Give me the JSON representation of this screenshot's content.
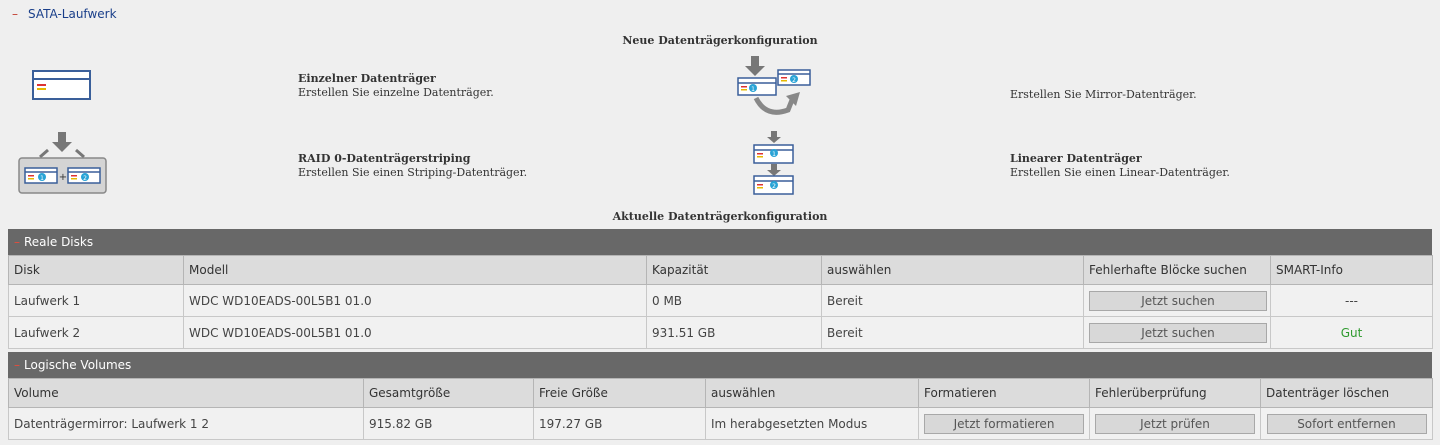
{
  "section": {
    "title": "SATA-Laufwerk",
    "collapse_glyph": "–"
  },
  "new_config": {
    "title": "Neue Datenträgerkonfiguration",
    "options": [
      {
        "title": "Einzelner Datenträger",
        "desc": "Erstellen Sie einzelne Datenträger.",
        "icon": "single-disk-icon"
      },
      {
        "title": "",
        "desc": "Erstellen Sie Mirror-Datenträger.",
        "icon": "mirror-disk-icon"
      },
      {
        "title": "RAID 0-Datenträgerstriping",
        "desc": "Erstellen Sie einen Striping-Datenträger.",
        "icon": "striping-disk-icon"
      },
      {
        "title": "Linearer Datenträger",
        "desc": "Erstellen Sie einen Linear-Datenträger.",
        "icon": "linear-disk-icon"
      }
    ]
  },
  "current_config": {
    "title": "Aktuelle Datenträgerkonfiguration"
  },
  "real_disks": {
    "title": "Reale Disks",
    "collapse_glyph": "–",
    "columns": [
      "Disk",
      "Modell",
      "Kapazität",
      "auswählen",
      "Fehlerhafte Blöcke suchen",
      "SMART-Info"
    ],
    "rows": [
      {
        "disk": "Laufwerk 1",
        "model": "WDC WD10EADS-00L5B1 01.0",
        "capacity": "0 MB",
        "status": "Bereit",
        "scan_label": "Jetzt suchen",
        "smart": "---"
      },
      {
        "disk": "Laufwerk 2",
        "model": "WDC WD10EADS-00L5B1 01.0",
        "capacity": "931.51 GB",
        "status": "Bereit",
        "scan_label": "Jetzt suchen",
        "smart": "Gut"
      }
    ]
  },
  "logical_volumes": {
    "title": "Logische Volumes",
    "collapse_glyph": "–",
    "columns": [
      "Volume",
      "Gesamtgröße",
      "Freie Größe",
      "auswählen",
      "Formatieren",
      "Fehlerüberprüfung",
      "Datenträger löschen"
    ],
    "rows": [
      {
        "volume": "Datenträgermirror: Laufwerk 1 2",
        "total": "915.82 GB",
        "free": "197.27 GB",
        "status": "Im herabgesetzten Modus",
        "format_label": "Jetzt formatieren",
        "check_label": "Jetzt prüfen",
        "delete_label": "Sofort entfernen"
      }
    ]
  },
  "colors": {
    "panel_header": "#686868",
    "good": "#2e9a2e",
    "link": "#1a3f8a",
    "minus": "#c0392b"
  }
}
